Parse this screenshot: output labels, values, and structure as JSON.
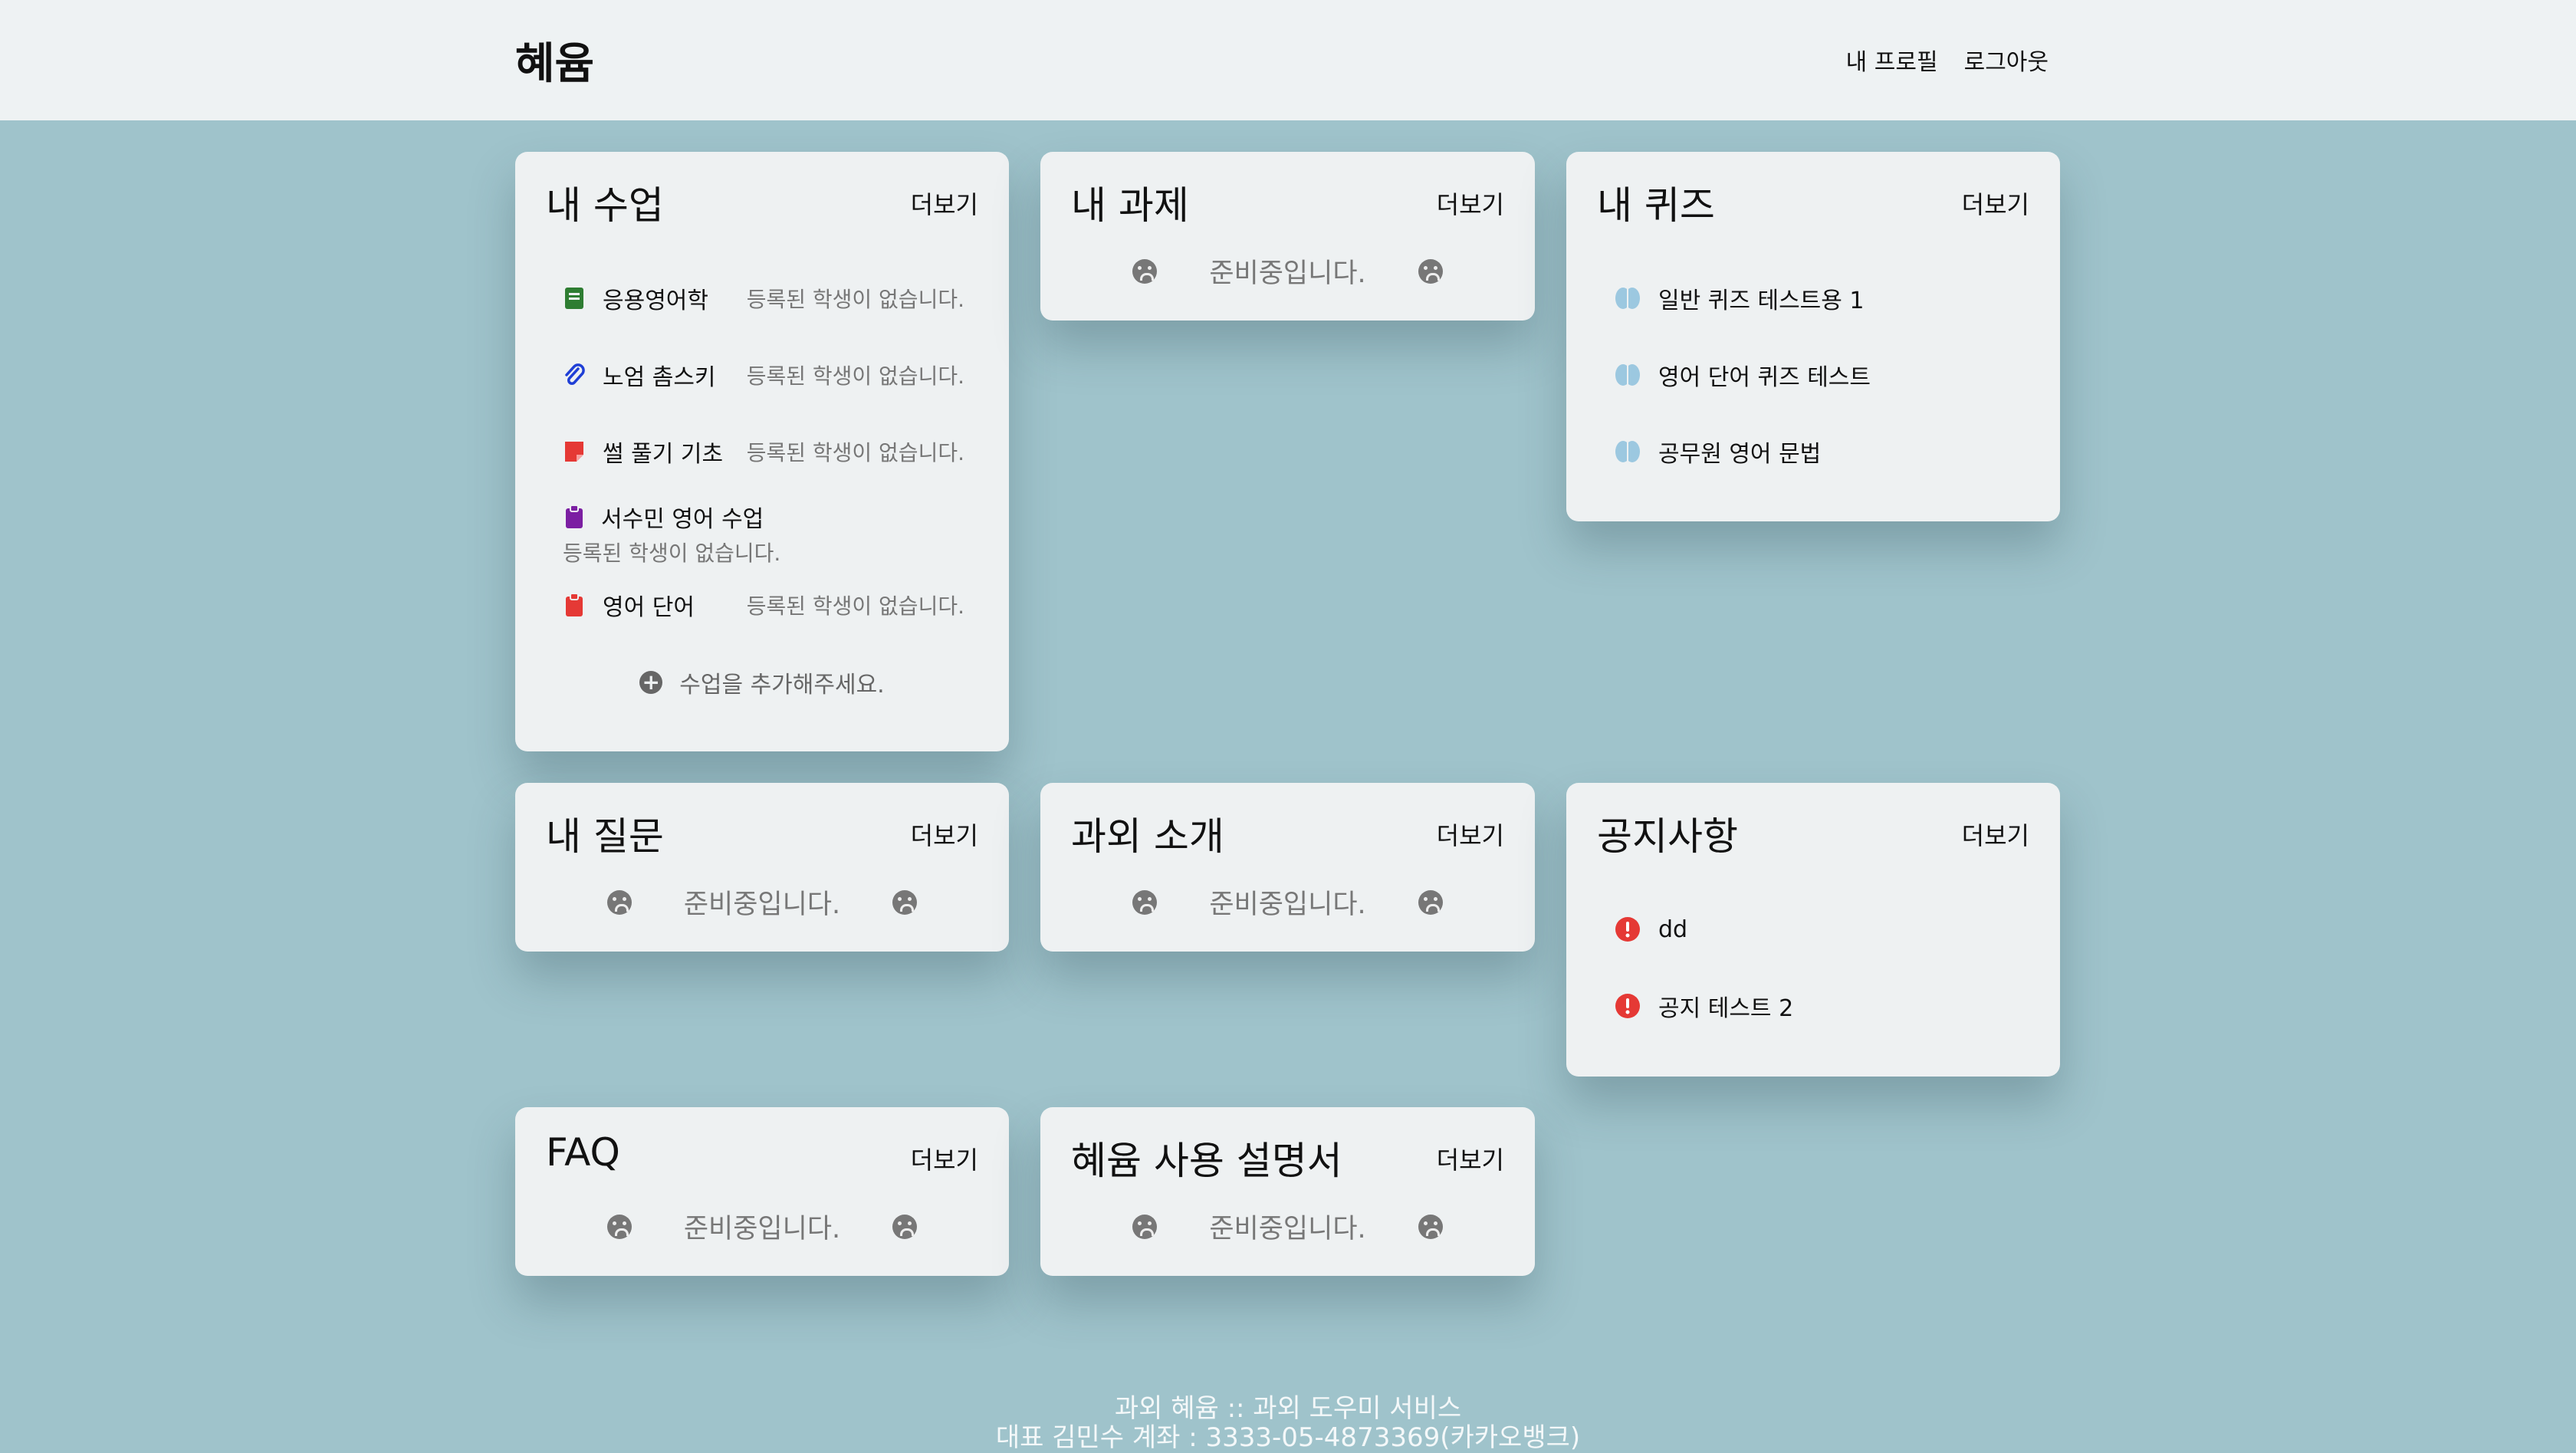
{
  "header": {
    "brand": "혜윰",
    "nav": [
      "내 프로필",
      "로그아웃"
    ]
  },
  "more_label": "더보기",
  "preparing_text": "준비중입니다.",
  "cards": {
    "classes": {
      "title": "내 수업",
      "items": [
        {
          "name": "응용영어학",
          "note": "등록된 학생이 없습니다.",
          "icon": "green-book-icon",
          "color": "#2e7d32"
        },
        {
          "name": "노엄 촘스키",
          "note": "등록된 학생이 없습니다.",
          "icon": "paperclip-icon",
          "color": "#1f3fd6"
        },
        {
          "name": "썰 풀기 기초",
          "note": "등록된 학생이 없습니다.",
          "icon": "sticky-note-icon",
          "color": "#e53935"
        },
        {
          "name": "서수민 영어 수업",
          "note": "등록된 학생이 없습니다.",
          "icon": "clipboard-icon",
          "color": "#7b1fa2"
        },
        {
          "name": "영어 단어",
          "note": "등록된 학생이 없습니다.",
          "icon": "clipboard-icon",
          "color": "#e53935"
        }
      ],
      "add_label": "수업을 추가해주세요."
    },
    "assignments": {
      "title": "내 과제"
    },
    "quizzes": {
      "title": "내 퀴즈",
      "items": [
        {
          "name": "일반 퀴즈 테스트용 1",
          "icon": "brain-icon",
          "color": "#9cc8e0"
        },
        {
          "name": "영어 단어 퀴즈 테스트",
          "icon": "brain-icon",
          "color": "#9cc8e0"
        },
        {
          "name": "공무원 영어 문법",
          "icon": "brain-icon",
          "color": "#9cc8e0"
        }
      ]
    },
    "questions": {
      "title": "내 질문"
    },
    "tutoring": {
      "title": "과외 소개"
    },
    "notices": {
      "title": "공지사항",
      "items": [
        {
          "name": "dd",
          "icon": "alert-icon",
          "color": "#e53935"
        },
        {
          "name": "공지 테스트 2",
          "icon": "alert-icon",
          "color": "#e53935"
        }
      ]
    },
    "faq": {
      "title": "FAQ"
    },
    "manual": {
      "title": "혜윰 사용 설명서"
    }
  },
  "footer": {
    "line1": "과외 혜윰 :: 과외 도우미 서비스",
    "line2": "대표 김민수 계좌 : 3333-05-4873369(카카오뱅크)"
  }
}
